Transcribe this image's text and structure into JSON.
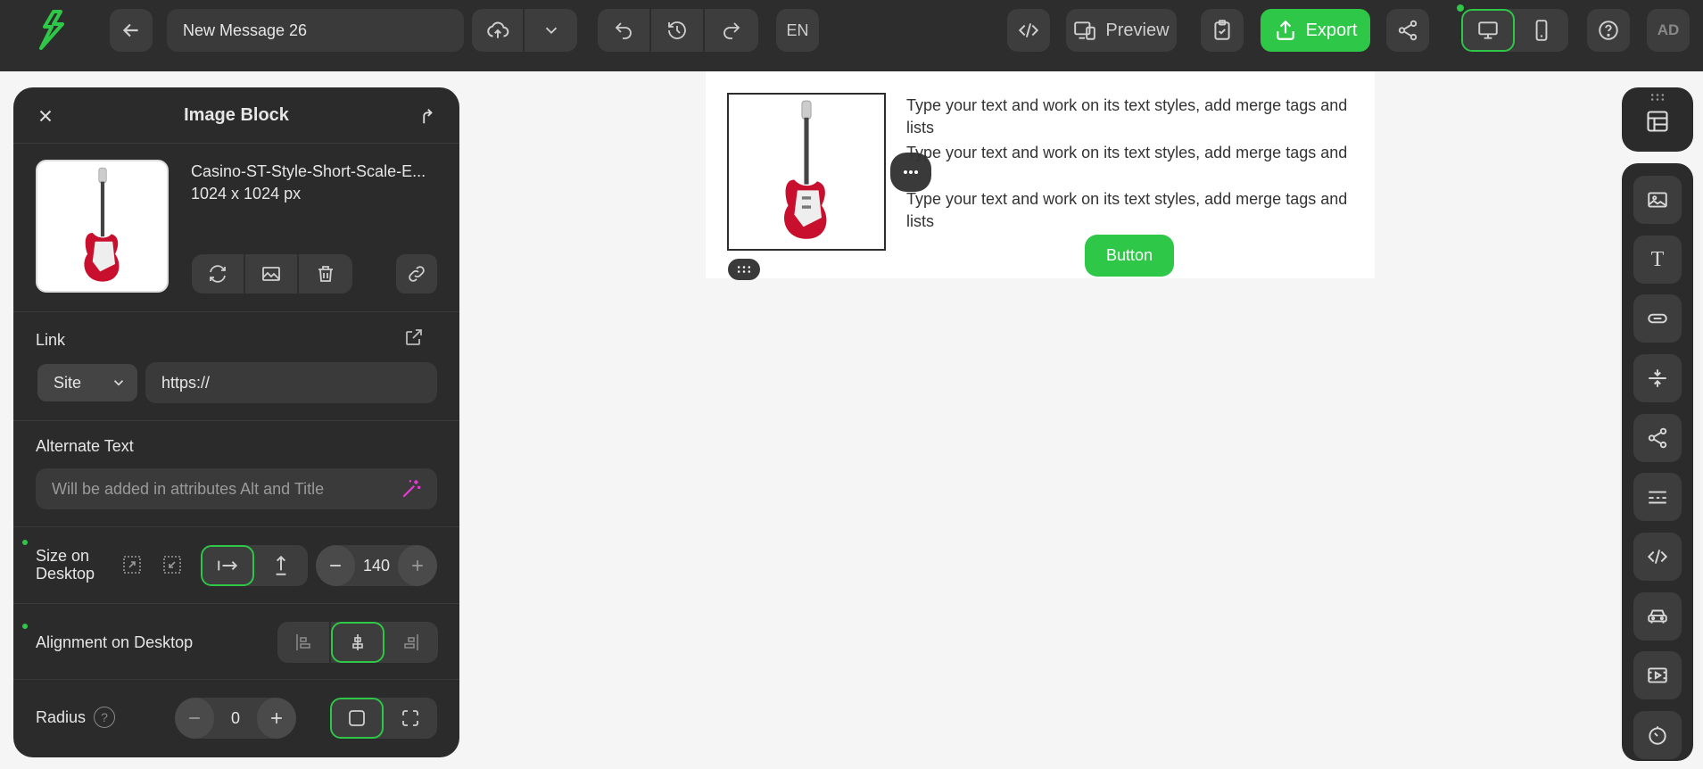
{
  "topbar": {
    "title": "New Message 26",
    "language": "EN",
    "preview_label": "Preview",
    "export_label": "Export",
    "avatar": "AD",
    "brand_color": "#2ec748"
  },
  "panel": {
    "title": "Image Block",
    "image": {
      "filename": "Casino-ST-Style-Short-Scale-E...",
      "dimensions": "1024 x 1024 px"
    },
    "link": {
      "label": "Link",
      "type": "Site",
      "value": "https://"
    },
    "alt_text": {
      "label": "Alternate Text",
      "placeholder": "Will be added in attributes Alt and Title"
    },
    "size": {
      "label_line1": "Size on",
      "label_line2": "Desktop",
      "value": "140"
    },
    "alignment": {
      "label": "Alignment on Desktop"
    },
    "radius": {
      "label": "Radius",
      "value": "0"
    }
  },
  "email": {
    "texts": [
      "Type your text and work on its text styles, add merge tags and lists",
      "Type your text and work on its text styles, add merge tags and",
      "Type your text and work on its text styles, add merge tags and lists"
    ],
    "button_label": "Button"
  }
}
